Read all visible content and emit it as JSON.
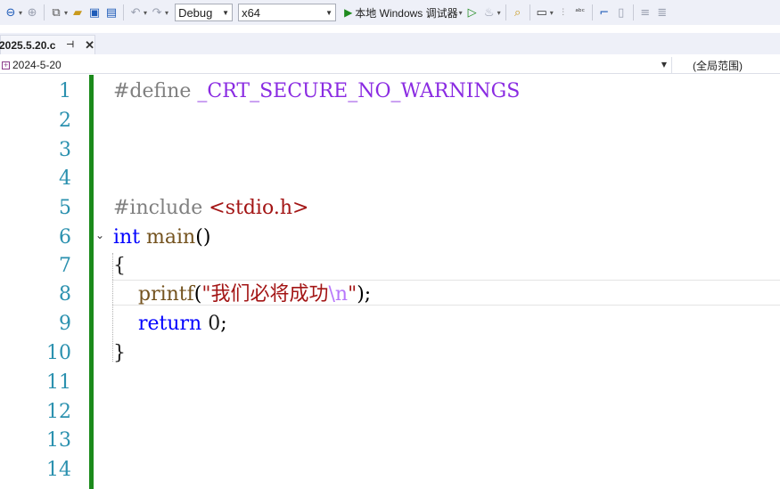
{
  "toolbar": {
    "configuration": "Debug",
    "platform": "x64",
    "run_label": "本地 Windows 调试器"
  },
  "tab": {
    "filename": "2025.5.20.c"
  },
  "navbar": {
    "project": "2024-5-20",
    "scope": "(全局范围)"
  },
  "editor": {
    "line_numbers": [
      "1",
      "2",
      "3",
      "4",
      "5",
      "6",
      "7",
      "8",
      "9",
      "10",
      "11",
      "12",
      "13",
      "14"
    ],
    "code": {
      "l1_directive": "#define",
      "l1_macro": "_CRT_SECURE_NO_WARNINGS",
      "l5_directive": "#include",
      "l5_header": "<stdio.h>",
      "l6_kw": "int",
      "l6_fn": "main",
      "l6_parens": "()",
      "l7_brace": "{",
      "l8_fn": "printf",
      "l8_open": "(",
      "l8_str": "\"我们必将成功",
      "l8_esc": "\\n",
      "l8_str_end": "\"",
      "l8_close": ");",
      "l9_kw": "return",
      "l9_num": "0",
      "l9_semi": ";",
      "l10_brace": "}"
    }
  },
  "colors": {
    "accent": "#1e5bb8",
    "change_bar": "#1b8a1b",
    "line_number": "#2b91af",
    "keyword": "#0000ff",
    "macro": "#8a2be2",
    "string": "#a31515"
  }
}
